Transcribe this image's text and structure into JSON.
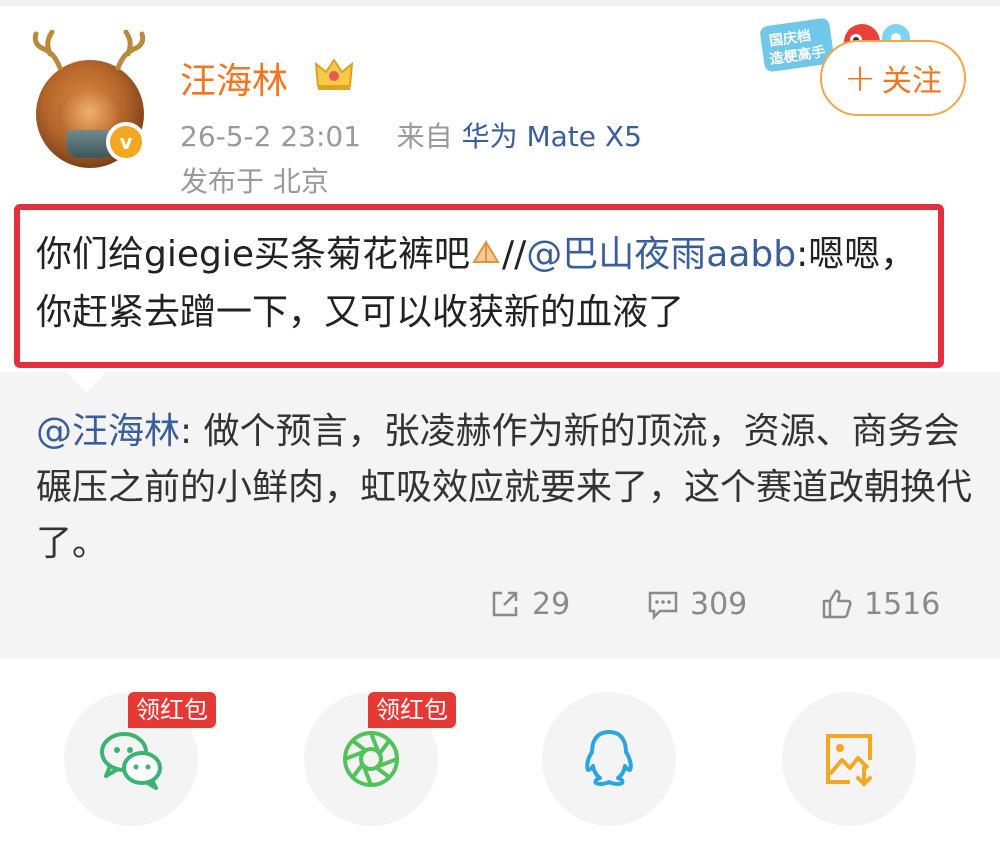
{
  "header": {
    "username": "汪海林",
    "timestamp": "26-5-2 23:01",
    "from_label": "来自",
    "source": "华为 Mate X5",
    "location": "发布于 北京",
    "follow_label": "关注",
    "promo_label": "国庆档 造梗高手"
  },
  "post": {
    "text_prefix": "你们给giegie买条菊花裤吧",
    "separator": "//",
    "mention": "@巴山夜雨aabb",
    "text_suffix": ":嗯嗯，你赶紧去蹭一下，又可以收获新的血液了"
  },
  "quote": {
    "mention": "@汪海林",
    "text": ": 做个预言，张凌赫作为新的顶流，资源、商务会碾压之前的小鲜肉，虹吸效应就要来了，这个赛道改朝换代了。"
  },
  "stats": {
    "reposts": "29",
    "comments": "309",
    "likes": "1516"
  },
  "share": {
    "red_packet_label": "领红包",
    "items": [
      "wechat-icon",
      "moments-icon",
      "qq-icon",
      "save-image-icon"
    ]
  },
  "colors": {
    "username": "#f2761f",
    "link": "#3a5d9c",
    "highlight_border": "#e4303d",
    "badge_red": "#e53935"
  }
}
